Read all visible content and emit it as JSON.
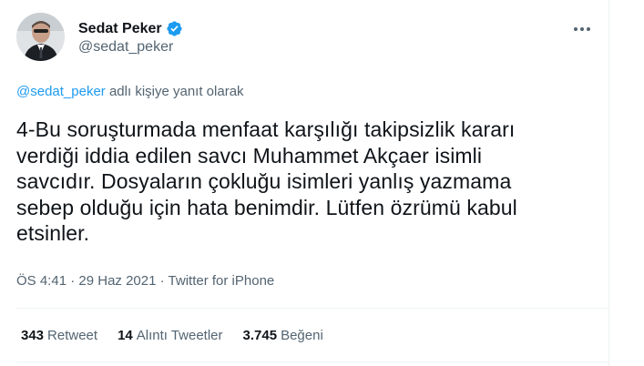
{
  "user": {
    "display_name": "Sedat Peker",
    "handle": "@sedat_peker",
    "verified": true
  },
  "reply": {
    "mention": "@sedat_peker",
    "suffix": " adlı kişiye yanıt olarak"
  },
  "tweet": {
    "lines": [
      "4-Bu soruşturmada menfaat karşılığı takipsizlik kararı",
      "verdiği iddia edilen savcı Muhammet Akçaer isimli",
      "savcıdır. Dosyaların çokluğu isimleri yanlış yazmama",
      "sebep olduğu için hata benimdir. Lütfen özrümü kabul",
      "etsinler."
    ]
  },
  "meta": {
    "time": "ÖS 4:41",
    "separator": " · ",
    "date": "29 Haz 2021",
    "source": "Twitter for iPhone"
  },
  "stats": {
    "retweets_count": "343",
    "retweets_label": "Retweet",
    "quotes_count": "14",
    "quotes_label": "Alıntı Tweetler",
    "likes_count": "3.745",
    "likes_label": "Beğeni"
  },
  "icons": {
    "verified": "verified-badge-icon",
    "more": "more-options-icon"
  },
  "colors": {
    "accent": "#1d9bf0",
    "secondary_text": "#536471",
    "primary_text": "#0f1419"
  }
}
